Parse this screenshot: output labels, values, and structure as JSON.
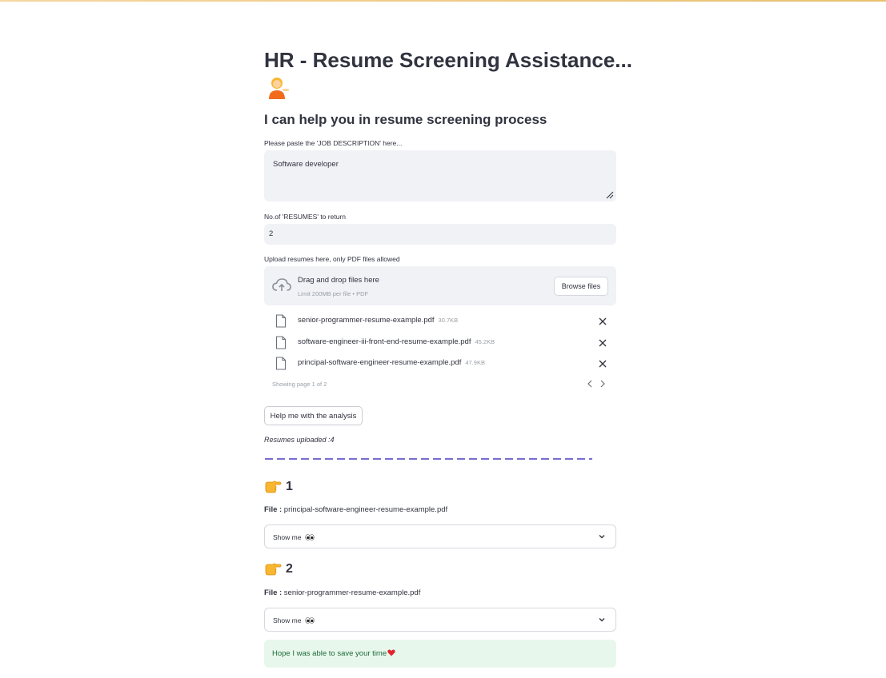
{
  "header": {
    "title": "HR - Resume Screening Assistance...",
    "title_emoji": "person-tipping-hand-emoji",
    "subtitle": "I can help you in resume screening process"
  },
  "job_description": {
    "label": "Please paste the 'JOB DESCRIPTION' here...",
    "value": "Software developer"
  },
  "resume_count": {
    "label": "No.of 'RESUMES' to return",
    "value": "2"
  },
  "uploader": {
    "label": "Upload resumes here, only PDF files allowed",
    "drop_text": "Drag and drop files here",
    "limit_text": "Limit 200MB per file • PDF",
    "browse_label": "Browse files",
    "files": [
      {
        "name": "senior-programmer-resume-example.pdf",
        "size": "30.7KB"
      },
      {
        "name": "software-engineer-iii-front-end-resume-example.pdf",
        "size": "45.2KB"
      },
      {
        "name": "principal-software-engineer-resume-example.pdf",
        "size": "47.9KB"
      }
    ],
    "pagination": "Showing page 1 of 2"
  },
  "actions": {
    "analyze_label": "Help me with the analysis",
    "uploaded_text": "Resumes uploaded :4"
  },
  "results": [
    {
      "rank": "1",
      "file_label": "File :",
      "file_name": " principal-software-engineer-resume-example.pdf",
      "expander_label": "Show me"
    },
    {
      "rank": "2",
      "file_label": "File :",
      "file_name": " senior-programmer-resume-example.pdf",
      "expander_label": "Show me"
    }
  ],
  "footer": {
    "success_text": "Hope I was able to save your time"
  },
  "colors": {
    "accent_dash": "#7b6fd0",
    "input_bg": "#f0f2f6",
    "success_bg": "#e8f7ec",
    "success_text": "#1f6b3a",
    "text": "#31333f",
    "muted": "#9aa0a6"
  },
  "icons": {
    "rank": "backhand-index-pointing-right-emoji",
    "eyes": "eyes-emoji",
    "heart": "red-heart-emoji"
  }
}
